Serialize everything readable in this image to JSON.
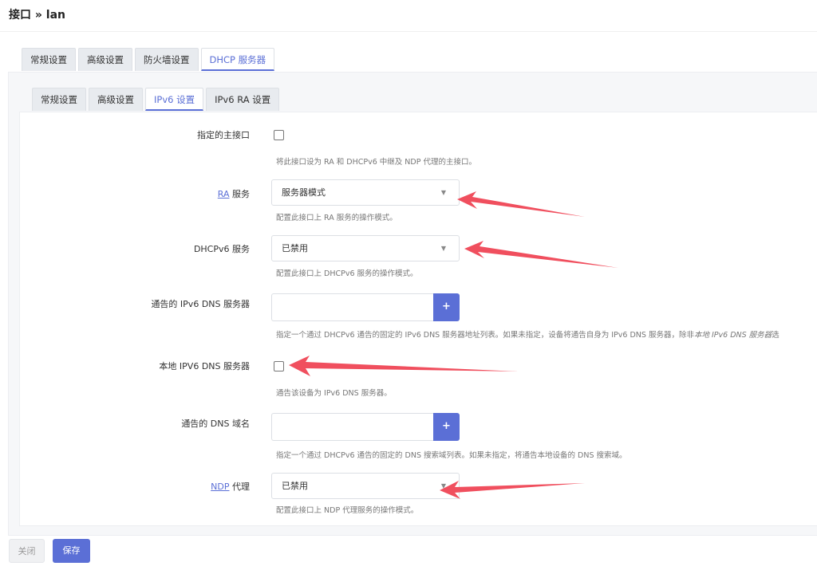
{
  "page_title": "接口 » lan",
  "outer_tabs": [
    "常规设置",
    "高级设置",
    "防火墙设置",
    "DHCP 服务器"
  ],
  "outer_active": "DHCP 服务器",
  "inner_tabs": [
    "常规设置",
    "高级设置",
    "IPv6 设置",
    "IPv6 RA 设置"
  ],
  "inner_active": "IPv6 设置",
  "fields": {
    "master": {
      "label": "指定的主接口",
      "checked": false,
      "description": "将此接口设为 RA 和 DHCPv6 中继及 NDP 代理的主接口。"
    },
    "ra": {
      "label_link": "RA",
      "label_rest": " 服务",
      "value": "服务器模式",
      "description": "配置此接口上 RA 服务的操作模式。"
    },
    "dhcpv6": {
      "label": "DHCPv6 服务",
      "value": "已禁用",
      "description": "配置此接口上 DHCPv6 服务的操作模式。"
    },
    "dns_servers": {
      "label": "通告的 IPv6 DNS 服务器",
      "value": "",
      "add": "+",
      "description_start": "指定一个通过 DHCPv6 通告的固定的 IPv6 DNS 服务器地址列表。如果未指定，设备将通告自身为 IPv6 DNS 服务器，除非",
      "description_em": "本地 IPv6 DNS 服务器",
      "description_end": "选"
    },
    "local_dns": {
      "label": "本地 IPV6 DNS 服务器",
      "checked": false,
      "description": "通告该设备为 IPv6 DNS 服务器。"
    },
    "dns_domains": {
      "label": "通告的 DNS 域名",
      "value": "",
      "add": "+",
      "description": "指定一个通过 DHCPv6 通告的固定的 DNS 搜索域列表。如果未指定，将通告本地设备的 DNS 搜索域。"
    },
    "ndp": {
      "label_link": "NDP",
      "label_rest": " 代理",
      "value": "已禁用",
      "description": "配置此接口上 NDP 代理服务的操作模式。"
    }
  },
  "buttons": {
    "close": "关闭",
    "save": "保存"
  },
  "colors": {
    "accent": "#5b6fd6",
    "annotation_arrow": "#f04f5e"
  }
}
